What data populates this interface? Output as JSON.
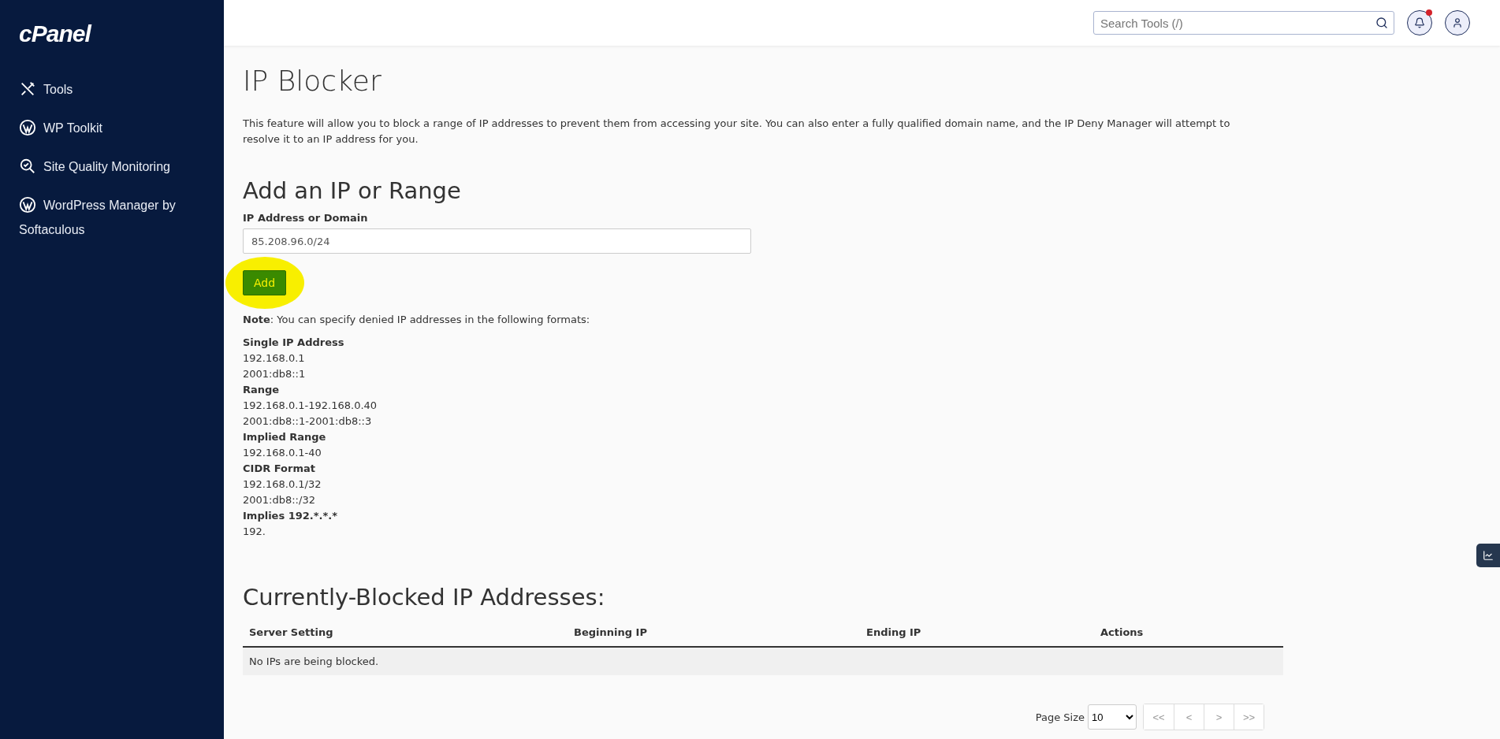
{
  "sidebar": {
    "logo": "cPanel",
    "items": [
      {
        "label": "Tools",
        "kind": "tools"
      },
      {
        "label": "WP Toolkit",
        "kind": "wordpress"
      },
      {
        "label": "Site Quality Monitoring",
        "kind": "monitor"
      },
      {
        "label": "WordPress Manager by Softaculous",
        "kind": "wordpress"
      }
    ]
  },
  "header": {
    "search": {
      "placeholder": "Search Tools (/)"
    },
    "notifications": {
      "unread": true
    }
  },
  "page": {
    "title": "IP Blocker",
    "description": "This feature will allow you to block a range of IP addresses to prevent them from accessing your site. You can also enter a fully qualified domain name, and the IP Deny Manager will attempt to resolve it to an IP address for you.",
    "add_section": {
      "title": "Add an IP or Range",
      "field_label": "IP Address or Domain",
      "field_value": "85.208.96.0/24",
      "button": "Add",
      "highlighted": true,
      "note": "**Note**: You can specify denied IP addresses in the following formats:",
      "formats": [
        {
          "kind": "heading",
          "text": "Single IP Address"
        },
        {
          "kind": "value",
          "text": "192.168.0.1"
        },
        {
          "kind": "value",
          "text": "2001:db8::1"
        },
        {
          "kind": "heading",
          "text": "Range"
        },
        {
          "kind": "value",
          "text": "192.168.0.1-192.168.0.40"
        },
        {
          "kind": "value",
          "text": "2001:db8::1-2001:db8::3"
        },
        {
          "kind": "heading",
          "text": "Implied Range"
        },
        {
          "kind": "value",
          "text": "192.168.0.1-40"
        },
        {
          "kind": "heading",
          "text": "CIDR Format"
        },
        {
          "kind": "value",
          "text": "192.168.0.1/32"
        },
        {
          "kind": "value",
          "text": "2001:db8::/32"
        },
        {
          "kind": "heading",
          "text": "Implies 192.*.*.*"
        },
        {
          "kind": "value",
          "text": "192."
        }
      ]
    },
    "blocked": {
      "title": "Currently-Blocked IP Addresses:",
      "columns": [
        "Server Setting",
        "Beginning IP",
        "Ending IP",
        "Actions"
      ],
      "empty_message": "No IPs are being blocked."
    },
    "pagination": {
      "label": "Page Size",
      "page_size": "10",
      "buttons": [
        "<<",
        "<",
        ">",
        ">>"
      ]
    }
  }
}
